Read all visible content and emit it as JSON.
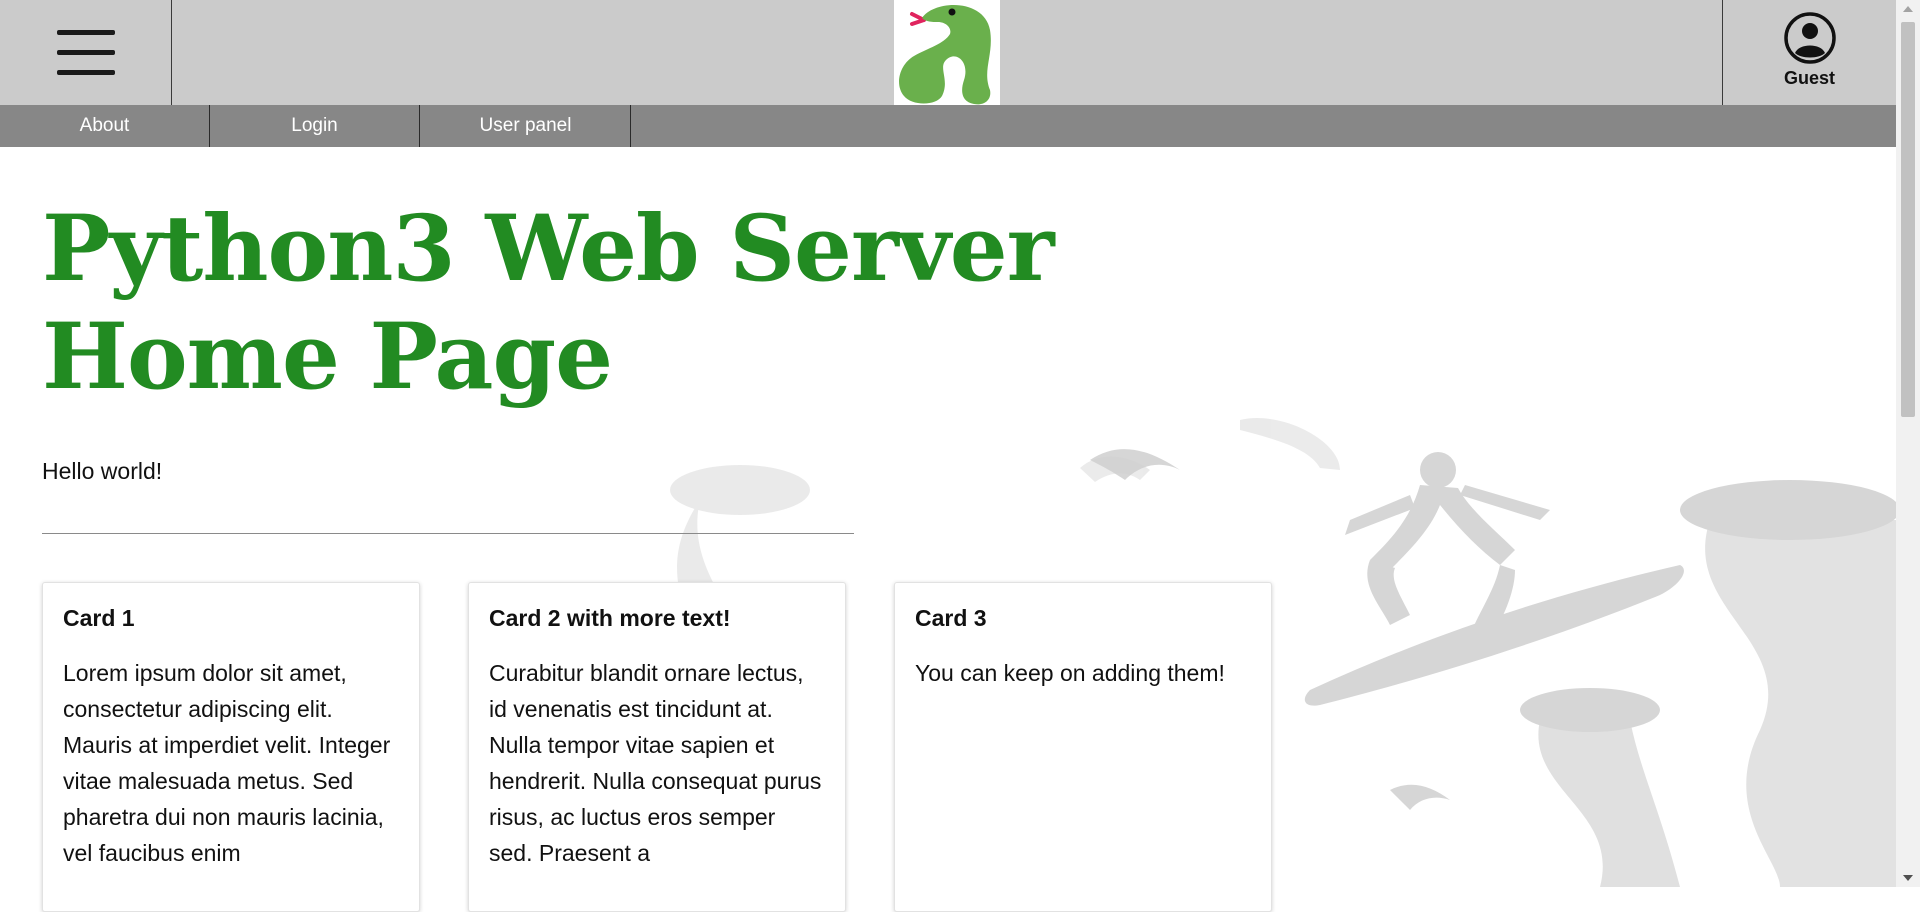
{
  "header": {
    "menu_icon": "hamburger-menu-icon",
    "logo_icon": "snake-logo-icon",
    "user_icon": "user-circle-icon",
    "user_label": "Guest"
  },
  "nav": {
    "items": [
      {
        "label": "About"
      },
      {
        "label": "Login"
      },
      {
        "label": "User panel"
      }
    ]
  },
  "main": {
    "title_line1": "Python3 Web Server",
    "title_line2": "Home Page",
    "greeting": "Hello world!"
  },
  "cards": [
    {
      "title": "Card 1",
      "body": "Lorem ipsum dolor sit amet, consectetur adipiscing elit. Mauris at imperdiet velit. Integer vitae malesuada metus. Sed pharetra dui non mauris lacinia, vel faucibus enim"
    },
    {
      "title": "Card 2 with more text!",
      "body": "Curabitur blandit ornare lectus, id venenatis est tincidunt at. Nulla tempor vitae sapien et hendrerit. Nulla consequat purus risus, ac luctus eros semper sed. Praesent a"
    },
    {
      "title": "Card 3",
      "body": "You can keep on adding them!"
    }
  ],
  "colors": {
    "title_green": "#228b22",
    "topbar": "#cbcbcb",
    "navbar": "#878787",
    "logo_snake": "#6ab04c",
    "logo_tongue": "#e0245e"
  }
}
